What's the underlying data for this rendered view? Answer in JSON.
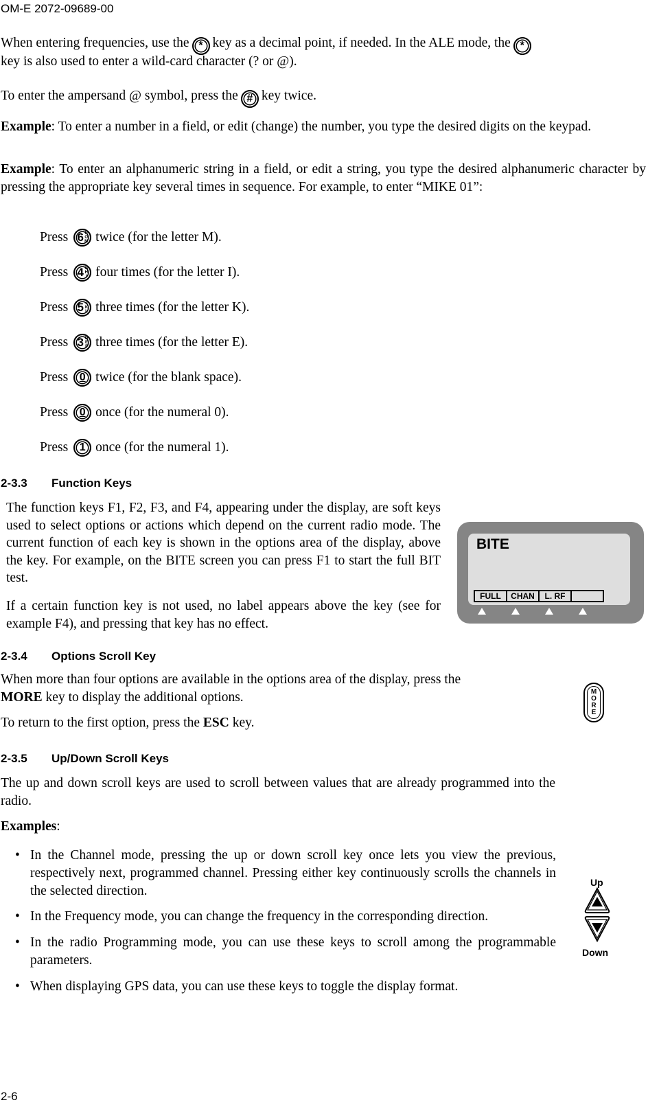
{
  "header": {
    "doc_id": "OM-E 2072-09689-00"
  },
  "footer": {
    "page_number": "2-6"
  },
  "intro": {
    "p1_a": "When entering frequencies, use the",
    "p1_b": "key as a decimal point, if needed. In the ALE mode, the",
    "p1_c": "key is also used to enter a wild-card character (? or @).",
    "star_key": "*",
    "p2_a": "To enter the ampersand @ symbol, press the",
    "p2_b": "key twice.",
    "hash_key": "#",
    "ex1_label": "Example",
    "ex1_text": ": To enter a number in a field, or edit (change) the number, you type the desired digits on the keypad.",
    "ex2_label": "Example",
    "ex2_text": ": To enter an alphanumeric string in a field, or edit a string, you type the desired alphanumeric character by pressing the appropriate key several times in sequence. For example, to enter “MIKE 01”:"
  },
  "press_steps": [
    {
      "prefix": "Press",
      "key": "6",
      "letters": [
        "N",
        "O",
        "M"
      ],
      "text": "twice (for the letter M)."
    },
    {
      "prefix": "Press",
      "key": "4",
      "letters": [
        "G",
        "H",
        "I"
      ],
      "text": "four times (for the letter I)."
    },
    {
      "prefix": "Press",
      "key": "5",
      "letters": [
        "J",
        "K",
        "L"
      ],
      "text": "three times (for the letter K)."
    },
    {
      "prefix": "Press",
      "key": "3",
      "letters": [
        "D",
        "E",
        "F"
      ],
      "text": "three times (for the letter E)."
    },
    {
      "prefix": "Press",
      "key": "0",
      "letters": [],
      "text": "twice (for the blank space)."
    },
    {
      "prefix": "Press",
      "key": "0",
      "letters": [],
      "text": "once (for the numeral 0)."
    },
    {
      "prefix": "Press",
      "key": "1",
      "letters": [],
      "text": "once (for the numeral 1)."
    }
  ],
  "sections": {
    "function_keys": {
      "number": "2-3.3",
      "title": "Function Keys",
      "p1": "The function keys F1, F2, F3, and F4, appearing under the display, are soft keys used to select options or actions which depend on the current radio mode. The current function of each key is shown in the options area of the display, above the key. For example, on the BITE screen you can press F1 to start the full BIT test.",
      "p2": "If a certain function key is not used, no label appears above the key (see for example F4), and pressing that key has no effect.",
      "display": {
        "title": "BITE",
        "options": [
          "FULL",
          "CHAN",
          "L. RF",
          ""
        ]
      }
    },
    "options_scroll": {
      "number": "2-3.4",
      "title": "Options Scroll Key",
      "p1_a": "When more than four options are available in the options area of the display, press the",
      "p1_bold": "MORE",
      "p1_b": " key to display the additional options.",
      "p2_a": "To return to the first option, press the ",
      "p2_bold": "ESC",
      "p2_b": " key.",
      "more_key_letters": [
        "M",
        "O",
        "R",
        "E"
      ]
    },
    "updown_scroll": {
      "number": "2-3.5",
      "title": "Up/Down Scroll Keys",
      "p1": "The up and down scroll keys are used to scroll between values that are already programmed into the radio.",
      "examples_label": "Examples",
      "examples_colon": ":",
      "bullets": [
        "In the Channel mode, pressing the up or down scroll key once lets you view the previous, respectively next, programmed channel. Pressing either key continuously scrolls the channels in the selected direction.",
        "In the Frequency mode, you can change the frequency in the corresponding direction.",
        "In the radio Programming mode, you can use these keys to scroll among the programmable parameters.",
        "When displaying GPS data, you can use these keys to toggle the display format."
      ],
      "up_label": "Up",
      "down_label": "Down"
    }
  }
}
